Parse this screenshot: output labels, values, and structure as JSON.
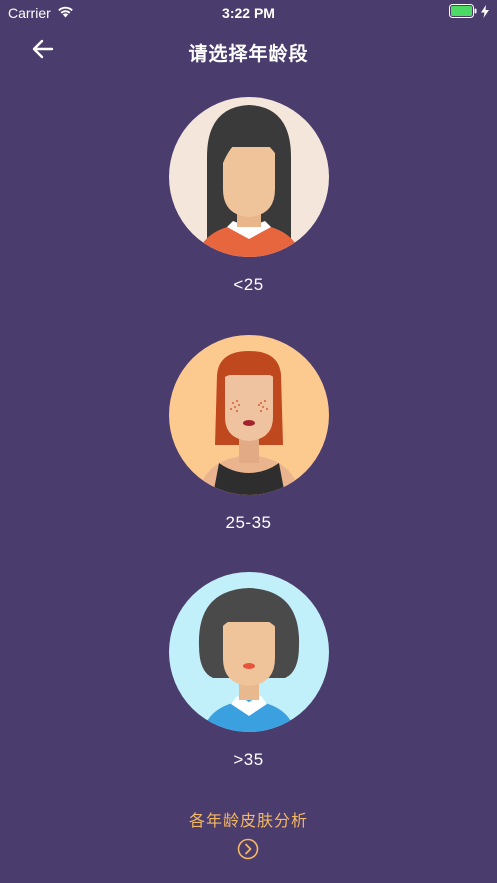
{
  "status_bar": {
    "carrier": "Carrier",
    "time": "3:22 PM",
    "wifi_icon": "wifi-icon",
    "battery_icon": "battery-icon",
    "charging_icon": "bolt-icon"
  },
  "nav": {
    "title": "请选择年龄段",
    "back_icon": "arrow-left-icon"
  },
  "options": [
    {
      "label": "<25",
      "avatar": "young-woman-avatar"
    },
    {
      "label": "25-35",
      "avatar": "redhead-woman-avatar"
    },
    {
      "label": ">35",
      "avatar": "mature-woman-avatar"
    }
  ],
  "footer": {
    "link_label": "各年龄皮肤分析",
    "arrow_icon": "chevron-right-circle-icon"
  },
  "colors": {
    "background": "#4b3c6e",
    "accent": "#f4b860",
    "text": "#ffffff"
  }
}
